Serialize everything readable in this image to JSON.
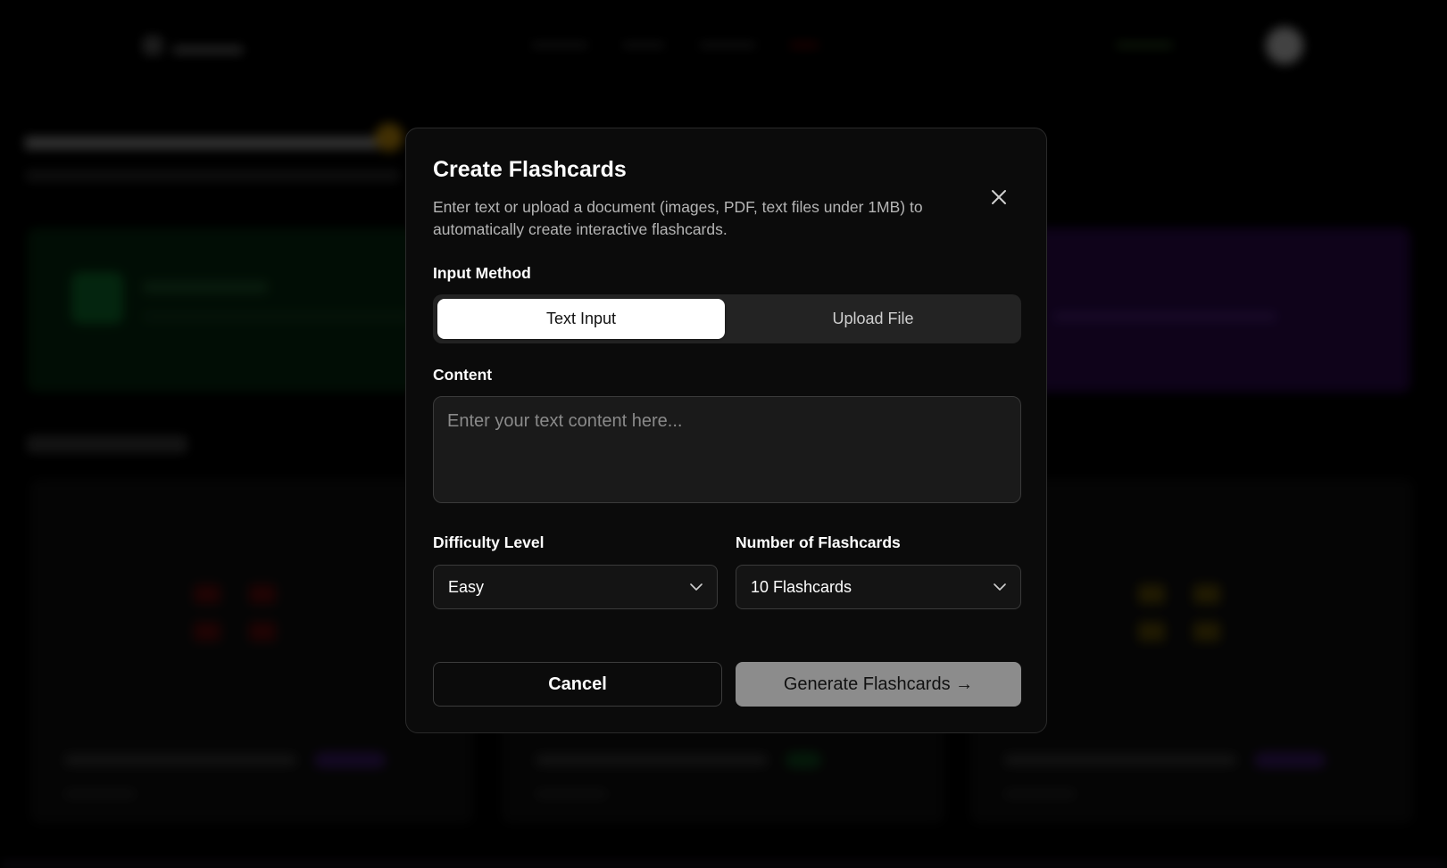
{
  "dialog": {
    "title": "Create Flashcards",
    "description": "Enter text or upload a document (images, PDF, text files under 1MB) to automatically create interactive flashcards.",
    "close_icon": "close-icon",
    "input_method": {
      "label": "Input Method",
      "options": [
        "Text Input",
        "Upload File"
      ],
      "selected": "Text Input"
    },
    "content": {
      "label": "Content",
      "placeholder": "Enter your text content here...",
      "value": ""
    },
    "difficulty": {
      "label": "Difficulty Level",
      "value": "Easy",
      "icon": "chevron-down-icon"
    },
    "count": {
      "label": "Number of Flashcards",
      "value": "10 Flashcards",
      "icon": "chevron-down-icon"
    },
    "cancel_label": "Cancel",
    "generate_label": "Generate Flashcards →"
  },
  "colors": {
    "dialog_bg": "#0b0b0b",
    "segment_bg": "#232323",
    "generate_bg": "#8c8c8c"
  }
}
